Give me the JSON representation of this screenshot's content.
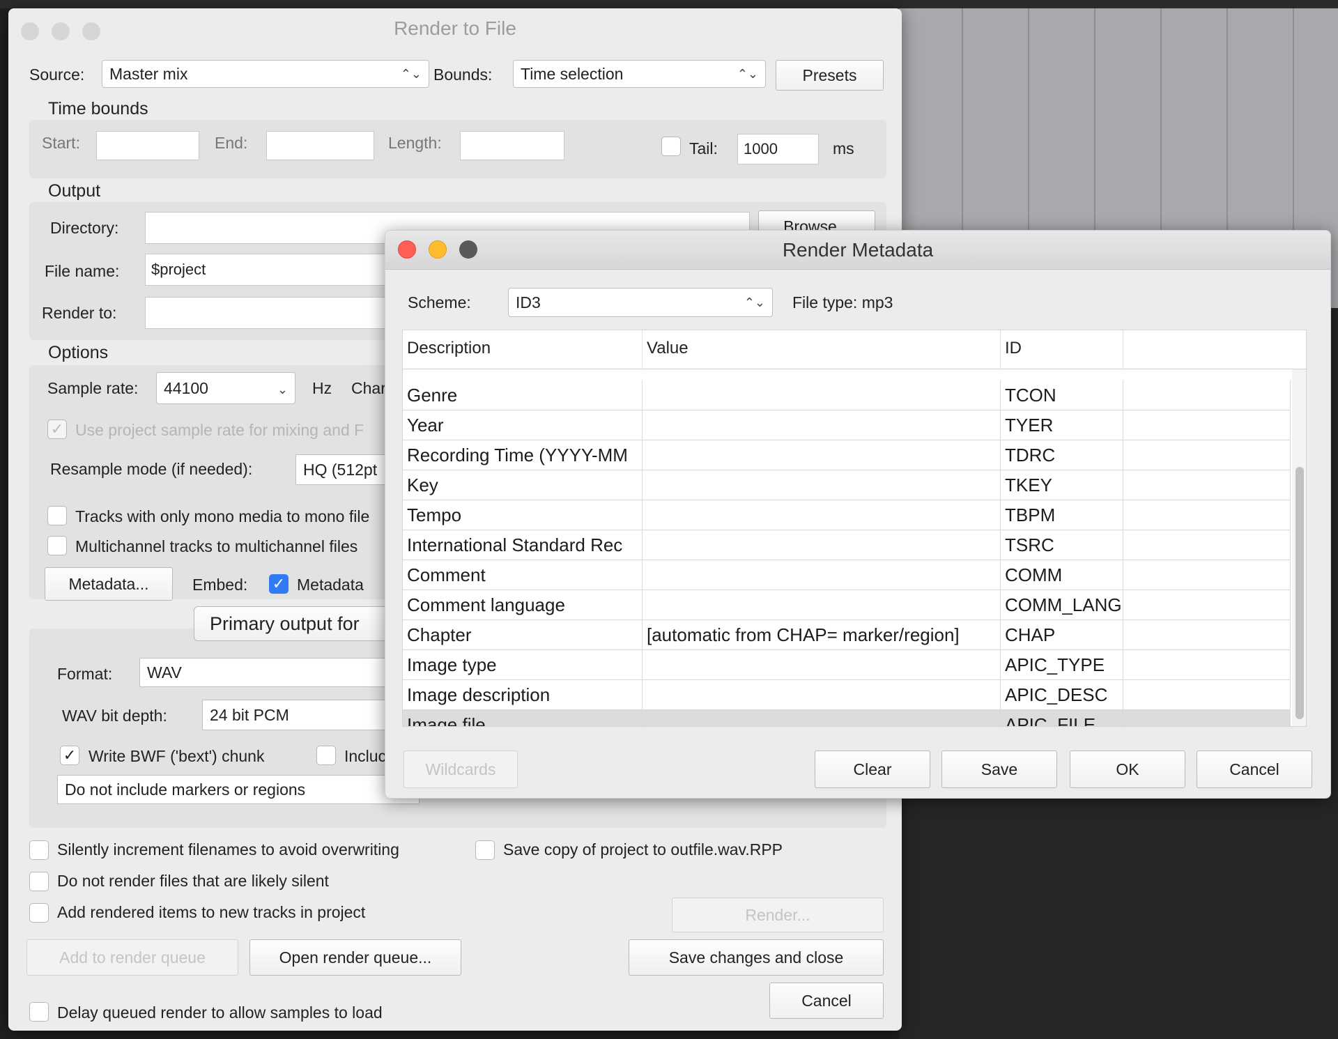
{
  "render": {
    "title": "Render to File",
    "source_label": "Source:",
    "source_value": "Master mix",
    "bounds_label": "Bounds:",
    "bounds_value": "Time selection",
    "presets_label": "Presets",
    "time_bounds": {
      "heading": "Time bounds",
      "start_label": "Start:",
      "end_label": "End:",
      "length_label": "Length:",
      "tail_label": "Tail:",
      "tail_value": "1000",
      "tail_unit": "ms"
    },
    "output": {
      "heading": "Output",
      "directory_label": "Directory:",
      "browse_label": "Browse...",
      "filename_label": "File name:",
      "filename_value": "$project",
      "renderto_label": "Render to:"
    },
    "options": {
      "heading": "Options",
      "samplerate_label": "Sample rate:",
      "samplerate_value": "44100",
      "samplerate_unit": "Hz",
      "channels_label": "Char",
      "use_project_rate": "Use project sample rate for mixing and F",
      "resample_label": "Resample mode (if needed):",
      "resample_value": "HQ (512pt",
      "mono_tracks": "Tracks with only mono media to mono file",
      "multichannel_tracks": "Multichannel tracks to multichannel files",
      "metadata_button": "Metadata...",
      "embed_label": "Embed:",
      "embed_metadata": "Metadata"
    },
    "format": {
      "tab_label": "Primary output for",
      "format_label": "Format:",
      "format_value": "WAV",
      "bitdepth_label": "WAV bit depth:",
      "bitdepth_value": "24 bit PCM",
      "bwf_label": "Write BWF ('bext') chunk",
      "include_label": "Incluc",
      "markers_value": "Do not include markers or regions"
    },
    "silently_increment": "Silently increment filenames to avoid overwriting",
    "save_copy": "Save copy of project to outfile.wav.RPP",
    "no_silent": "Do not render files that are likely silent",
    "add_rendered": "Add rendered items to new tracks in project",
    "render_button": "Render...",
    "add_queue": "Add to render queue",
    "open_queue": "Open render queue...",
    "save_close": "Save changes and close",
    "cancel": "Cancel",
    "delay_render": "Delay queued render to allow samples to load"
  },
  "metadata": {
    "title": "Render Metadata",
    "scheme_label": "Scheme:",
    "scheme_value": "ID3",
    "filetype": "File type: mp3",
    "columns": [
      "Description",
      "Value",
      "ID"
    ],
    "rows": [
      {
        "description": "Genre",
        "value": "",
        "id": "TCON"
      },
      {
        "description": "Year",
        "value": "",
        "id": "TYER"
      },
      {
        "description": "Recording Time (YYYY-MM",
        "value": "",
        "id": "TDRC"
      },
      {
        "description": "Key",
        "value": "",
        "id": "TKEY"
      },
      {
        "description": "Tempo",
        "value": "",
        "id": "TBPM"
      },
      {
        "description": "International Standard Rec",
        "value": "",
        "id": "TSRC"
      },
      {
        "description": "Comment",
        "value": "",
        "id": "COMM"
      },
      {
        "description": "Comment language",
        "value": "",
        "id": "COMM_LANG"
      },
      {
        "description": "Chapter",
        "value": "[automatic from CHAP= marker/region]",
        "id": "CHAP"
      },
      {
        "description": "Image type",
        "value": "",
        "id": "APIC_TYPE"
      },
      {
        "description": "Image description",
        "value": "",
        "id": "APIC_DESC"
      },
      {
        "description": "Image file",
        "value": "",
        "id": "APIC_FILE"
      }
    ],
    "wildcards": "Wildcards",
    "clear": "Clear",
    "save": "Save",
    "ok": "OK",
    "cancel": "Cancel"
  }
}
